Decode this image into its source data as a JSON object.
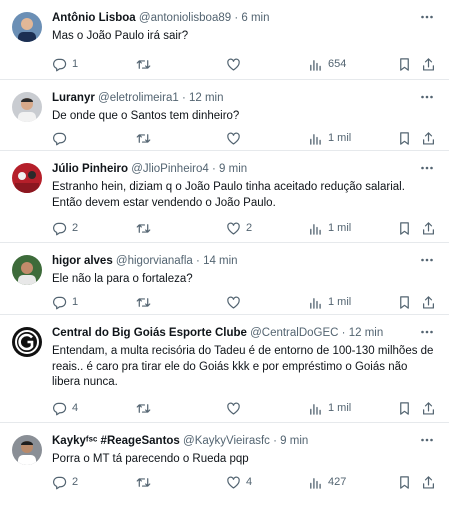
{
  "tweets": [
    {
      "name": "Antônio Lisboa",
      "handle": "@antoniolisboa89",
      "time": "6 min",
      "text": "Mas o João Paulo irá sair?",
      "replies": "1",
      "retweets": "",
      "likes": "",
      "views": "654"
    },
    {
      "name": "Luranyr",
      "handle": "@eletrolimeira1",
      "time": "12 min",
      "text": "De onde que o Santos tem dinheiro?",
      "replies": "",
      "retweets": "",
      "likes": "",
      "views": "1 mil"
    },
    {
      "name": "Júlio Pinheiro",
      "handle": "@JlioPinheiro4",
      "time": "9 min",
      "text": "Estranho hein, diziam q o João Paulo tinha aceitado redução salarial. Então devem estar vendendo o João Paulo.",
      "replies": "2",
      "retweets": "",
      "likes": "2",
      "views": "1 mil"
    },
    {
      "name": "higor alves",
      "handle": "@higorvianafla",
      "time": "14 min",
      "text": "Ele não la para o fortaleza?",
      "replies": "1",
      "retweets": "",
      "likes": "",
      "views": "1 mil"
    },
    {
      "name": "Central do Big Goiás Esporte Clube",
      "handle": "@CentralDoGEC",
      "time": "12 min",
      "text": "Entendam, a multa recisória do Tadeu é de entorno de 100-130 milhões de reais.. é caro pra tirar ele do Goiás kkk e por empréstimo o Goiás não libera nunca.",
      "replies": "4",
      "retweets": "",
      "likes": "",
      "views": "1 mil"
    },
    {
      "name": "Kaykyᶠˢᶜ #ReageSantos",
      "handle": "@KaykyVieirasfc",
      "time": "9 min",
      "text": "Porra o MT tá parecendo o Rueda pqp",
      "replies": "2",
      "retweets": "",
      "likes": "4",
      "views": "427"
    }
  ],
  "separator": "·",
  "icons": {
    "reply": "reply-icon",
    "retweet": "retweet-icon",
    "like": "heart-icon",
    "views": "views-chart-icon",
    "bookmark": "bookmark-icon",
    "share": "share-icon",
    "more": "more-options-icon"
  },
  "colors": {
    "text": "#0f1419",
    "secondary": "#536471",
    "divider": "#e6e9ec"
  }
}
